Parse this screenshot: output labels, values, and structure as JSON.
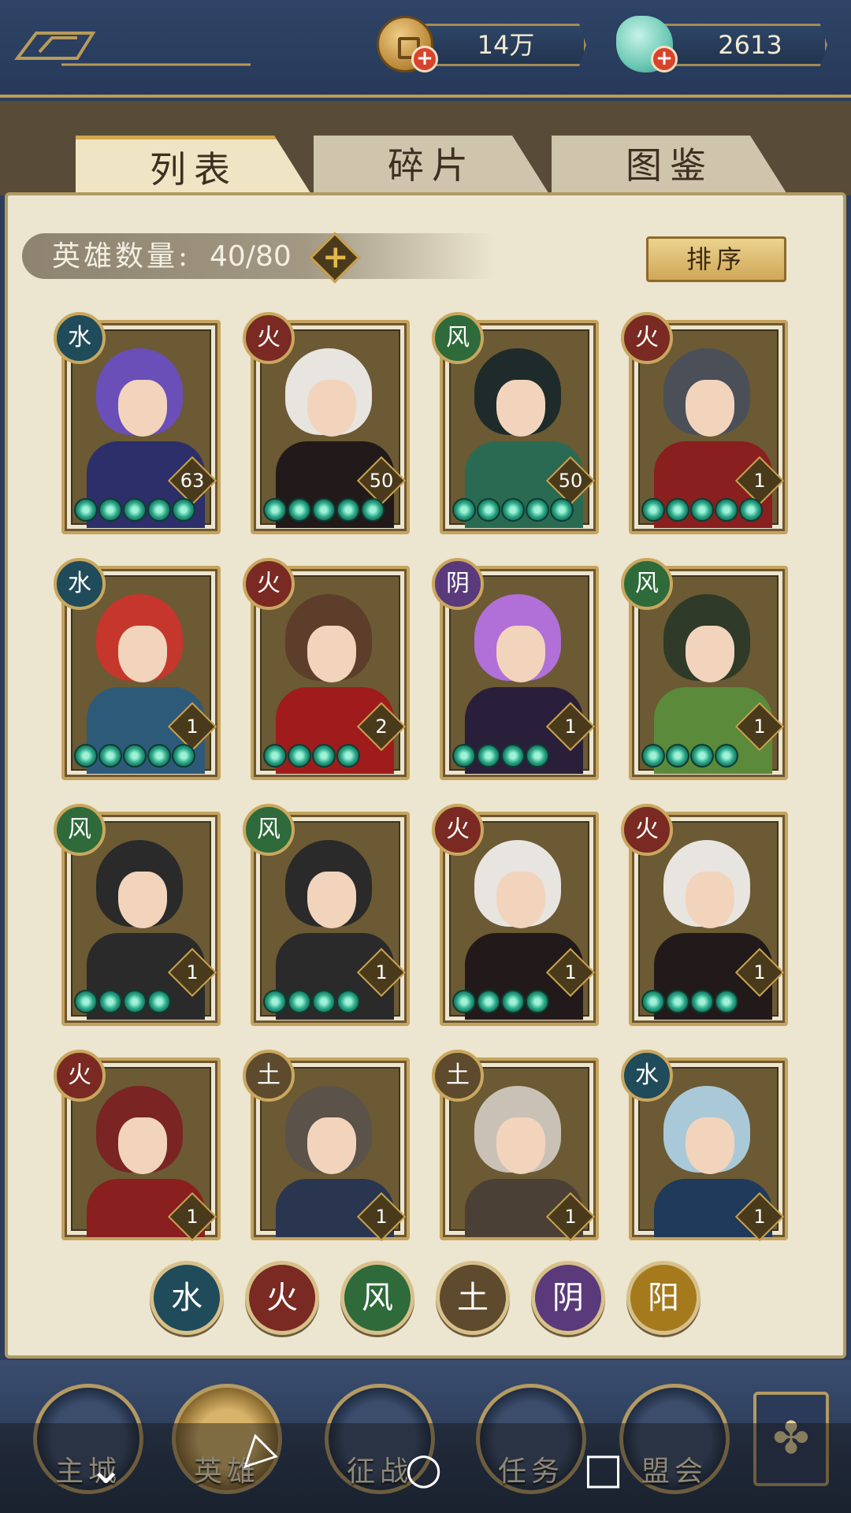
{
  "header": {
    "coins": "14万",
    "gems": "2613"
  },
  "tabs": [
    {
      "label": "列表"
    },
    {
      "label": "碎片"
    },
    {
      "label": "图鉴"
    }
  ],
  "hero_count": {
    "label": "英雄数量:",
    "value": "40/80"
  },
  "sort_label": "排序",
  "heroes": [
    {
      "element": "水",
      "level": "63",
      "stars": 5
    },
    {
      "element": "火",
      "level": "50",
      "stars": 5
    },
    {
      "element": "风",
      "level": "50",
      "stars": 5
    },
    {
      "element": "火",
      "level": "1",
      "stars": 5
    },
    {
      "element": "水",
      "level": "1",
      "stars": 5
    },
    {
      "element": "火",
      "level": "2",
      "stars": 4
    },
    {
      "element": "阴",
      "level": "1",
      "stars": 4
    },
    {
      "element": "风",
      "level": "1",
      "stars": 4
    },
    {
      "element": "风",
      "level": "1",
      "stars": 4
    },
    {
      "element": "风",
      "level": "1",
      "stars": 4
    },
    {
      "element": "火",
      "level": "1",
      "stars": 4
    },
    {
      "element": "火",
      "level": "1",
      "stars": 4
    },
    {
      "element": "火",
      "level": "1",
      "stars": 0
    },
    {
      "element": "土",
      "level": "1",
      "stars": 0
    },
    {
      "element": "土",
      "level": "1",
      "stars": 0
    },
    {
      "element": "水",
      "level": "1",
      "stars": 0
    }
  ],
  "filters": [
    {
      "glyph": "水"
    },
    {
      "glyph": "火"
    },
    {
      "glyph": "风"
    },
    {
      "glyph": "土"
    },
    {
      "glyph": "阴"
    },
    {
      "glyph": "阳"
    }
  ],
  "nav": [
    {
      "label": "主城"
    },
    {
      "label": "英雄"
    },
    {
      "label": "征战"
    },
    {
      "label": "任务"
    },
    {
      "label": "盟会"
    }
  ],
  "icons": {
    "coin": "coin-icon",
    "gem": "gem-icon",
    "add": "plus-icon",
    "extra": "clover-menu-icon",
    "sys_back": "back-chevron-icon",
    "sys_home": "home-circle-icon",
    "sys_recent": "recent-square-icon"
  }
}
